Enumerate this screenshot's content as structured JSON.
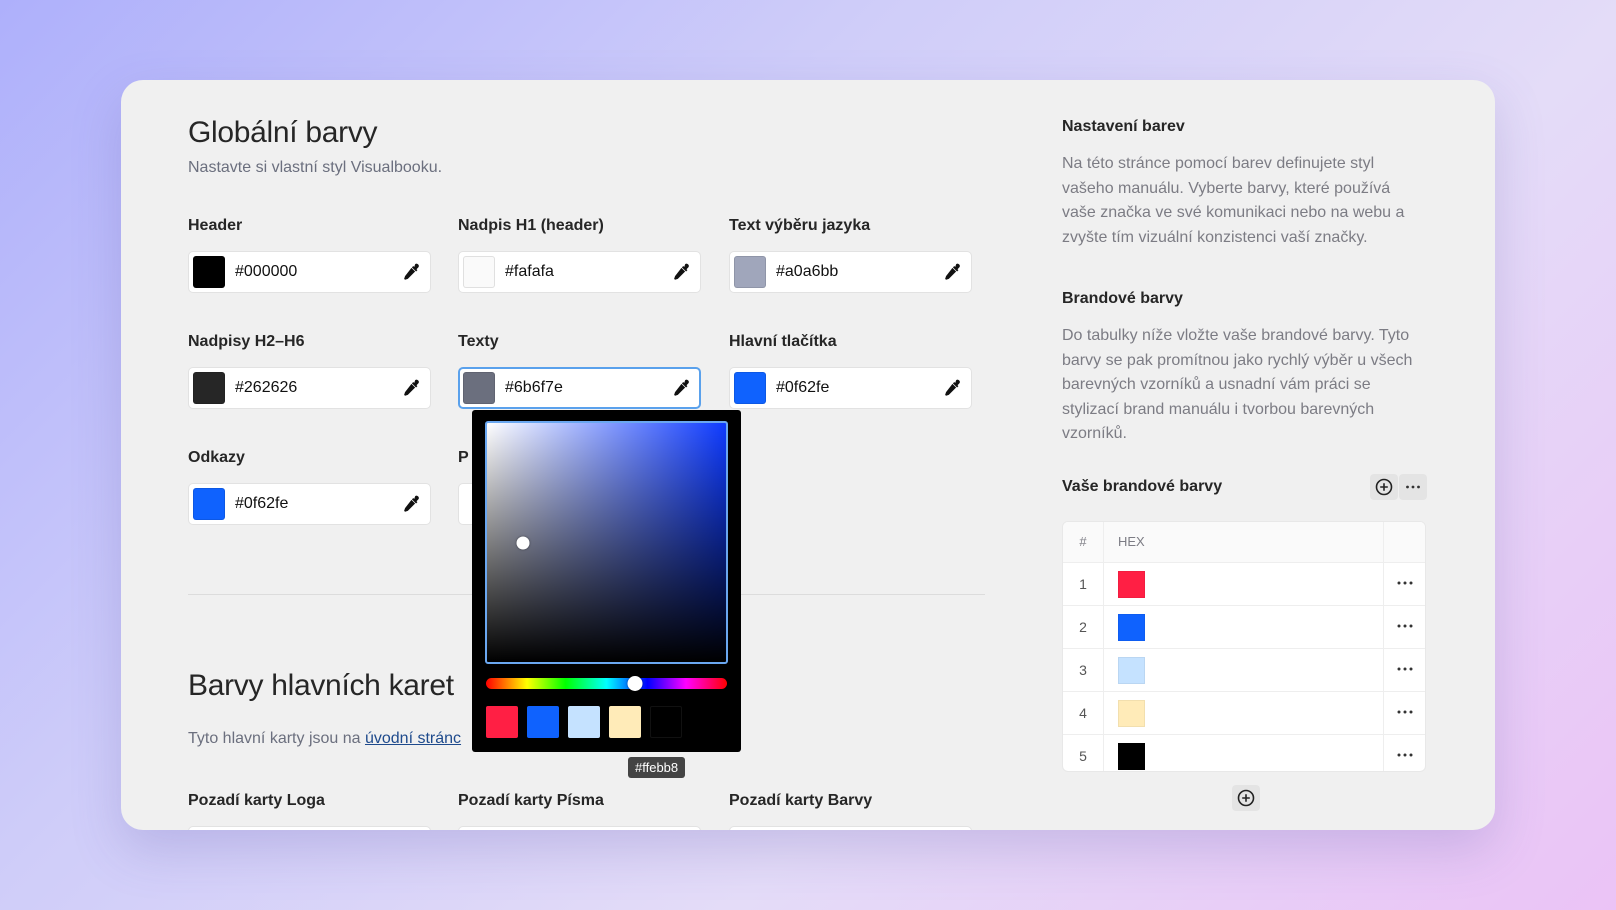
{
  "global": {
    "title": "Globální barvy",
    "subtitle": "Nastavte si vlastní styl Visualbooku.",
    "fields": [
      {
        "label": "Header",
        "hex": "#000000",
        "color": "#000000"
      },
      {
        "label": "Nadpis H1 (header)",
        "hex": "#fafafa",
        "color": "#fafafa"
      },
      {
        "label": "Text výběru jazyka",
        "hex": "#a0a6bb",
        "color": "#a0a6bb"
      },
      {
        "label": "Nadpisy H2–H6",
        "hex": "#262626",
        "color": "#262626"
      },
      {
        "label": "Texty",
        "hex": "#6b6f7e",
        "color": "#6b6f7e"
      },
      {
        "label": "Hlavní tlačítka",
        "hex": "#0f62fe",
        "color": "#0f62fe"
      },
      {
        "label": "Odkazy",
        "hex": "#0f62fe",
        "color": "#0f62fe"
      }
    ],
    "partial_label": "P"
  },
  "cards": {
    "title": "Barvy hlavních karet",
    "subtitle_prefix": "Tyto hlavní karty jsou na ",
    "subtitle_link": "úvodní stránc",
    "fields": [
      {
        "label": "Pozadí karty Loga"
      },
      {
        "label": "Pozadí karty Písma"
      },
      {
        "label": "Pozadí karty Barvy"
      }
    ]
  },
  "sidebar": {
    "settings_title": "Nastavení barev",
    "settings_text": "Na této stránce pomocí barev definujete styl vašeho manuálu. Vyberte barvy, které používá vaše značka ve své komunikaci nebo na webu a zvyšte tím vizuální konzistenci vaší značky.",
    "brand_title": "Brandové barvy",
    "brand_text": "Do tabulky níže vložte vaše brandové barvy. Tyto barvy se pak promítnou jako rychlý výběr u všech barevných vzorníků a usnadní vám práci se stylizací brand manuálu i tvorbou barevných vzorníků.",
    "table_title": "Vaše brandové barvy",
    "columns": {
      "num": "#",
      "hex": "HEX"
    },
    "rows": [
      {
        "num": "1",
        "color": "#ff1f44"
      },
      {
        "num": "2",
        "color": "#0f62fe"
      },
      {
        "num": "3",
        "color": "#c5e2ff"
      },
      {
        "num": "4",
        "color": "#ffebb8"
      },
      {
        "num": "5",
        "color": "#000000"
      }
    ]
  },
  "picker": {
    "hue_color": "#0f3bff",
    "saturation": 0.15,
    "value": 0.5,
    "hue_fraction": 0.62,
    "swatches": [
      "#ff1f44",
      "#0f62fe",
      "#c5e2ff",
      "#ffebb8",
      "#000000"
    ],
    "tooltip": "#ffebb8"
  },
  "icons": {
    "eyedropper": "eyedropper-icon",
    "plus_circle": "plus-circle-icon",
    "more": "more-horizontal-icon"
  }
}
